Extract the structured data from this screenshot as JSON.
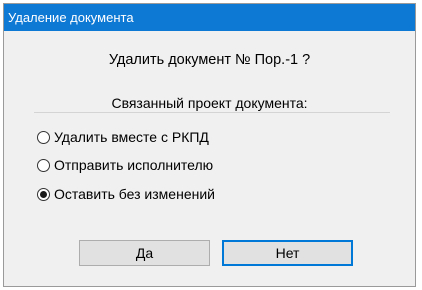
{
  "window": {
    "title": "Удаление документа"
  },
  "prompt": {
    "text": "Удалить документ № Пор.-1 ?"
  },
  "group": {
    "label": "Связанный проект документа:",
    "options": [
      {
        "label": "Удалить вместе с РКПД",
        "selected": false
      },
      {
        "label": "Отправить исполнителю",
        "selected": false
      },
      {
        "label": "Оставить без изменений",
        "selected": true
      }
    ]
  },
  "buttons": {
    "yes_label": "Да",
    "no_label": "Нет"
  }
}
